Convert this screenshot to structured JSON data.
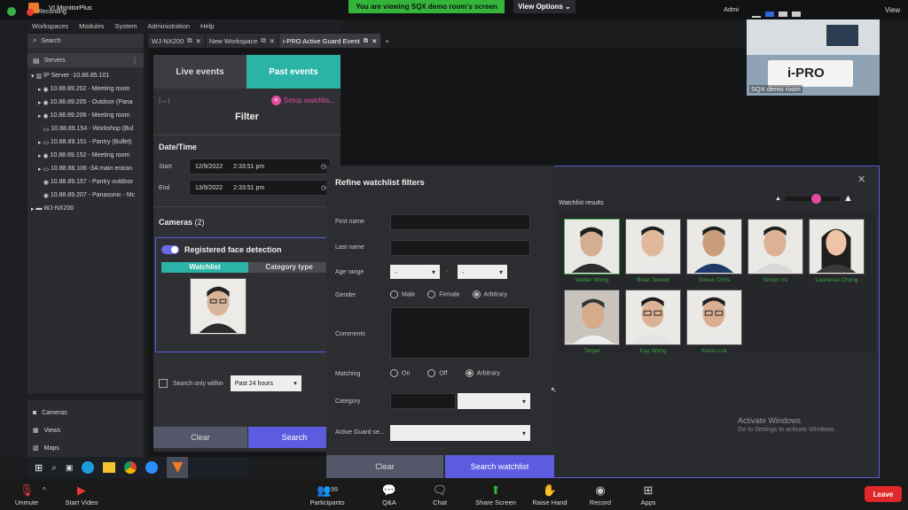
{
  "titlebar": {
    "app_title": "VI MonitorPlus",
    "recording": "Recording",
    "banner": "You are viewing SQX demo room's screen",
    "view_options": "View Options",
    "admin_label": "Admi",
    "view_label": "View"
  },
  "menu": [
    "Workspaces",
    "Modules",
    "System",
    "Administration",
    "Help"
  ],
  "sidebar": {
    "search": "Search",
    "servers": "Servers",
    "tree": [
      {
        "label": "IP Server -10.88.85.101",
        "level": 0
      },
      {
        "label": "10.88.89.202 - Meeting room",
        "level": 1
      },
      {
        "label": "10.88.89.205 - Outdoor (Pana",
        "level": 1
      },
      {
        "label": "10.88.89.206 - Meeting room",
        "level": 1
      },
      {
        "label": "10.88.89.154 - Workshop (Bul",
        "level": 1
      },
      {
        "label": "10.88.89.151 - Pantry (Bullet)",
        "level": 1
      },
      {
        "label": "10.88.89.152 - Meeting room",
        "level": 1
      },
      {
        "label": "10.88.88.106 -3A main entran",
        "level": 1
      },
      {
        "label": "10.88.89.157 - Pantry outdoor",
        "level": 1
      },
      {
        "label": "10.88.89.207 - Panasonic - Mc",
        "level": 1
      },
      {
        "label": "WJ-NX200",
        "level": 0
      }
    ],
    "bottom": [
      "Cameras",
      "Views",
      "Maps"
    ]
  },
  "tabs": [
    "WJ-NX200",
    "New Workspace",
    "i-PRO Active Guard Event"
  ],
  "panel": {
    "live_events": "Live events",
    "past_events": "Past events",
    "setup_watchlist": "Setup watchlis...",
    "filter": "Filter",
    "date_time": "Date/Time",
    "start_label": "Start",
    "start_date": "12/9/2022",
    "start_time": "2:33:51 pm",
    "end_label": "End",
    "end_date": "13/9/2022",
    "end_time": "2:33:51 pm",
    "cameras": "Cameras",
    "cameras_count": "(2)",
    "registered_face": "Registered face detection",
    "watchlist_tab": "Watchlist",
    "category_tab": "Category type",
    "search_only": "Search only within",
    "past_24": "Past 24 hours",
    "clear": "Clear",
    "search": "Search"
  },
  "modal": {
    "title": "Refine watchlist filters",
    "first_name": "First name",
    "last_name": "Last name",
    "age_range": "Age range",
    "age_from": "-",
    "age_to": "-",
    "gender": "Gender",
    "male": "Male",
    "female": "Female",
    "arbitrary": "Arbitrary",
    "comments": "Comments",
    "matching": "Matching",
    "on": "On",
    "off": "Off",
    "category": "Category",
    "active_guard": "Active Guard se...",
    "clear": "Clear",
    "search_watchlist": "Search watchlist",
    "results_title": "Watchlist results",
    "results": [
      "Walter Wong",
      "Brian Teonet",
      "Simon Chris",
      "Simon Yu",
      "Laurence Chong",
      "Target",
      "Kay Wong",
      "Kevin Lok"
    ],
    "activate_title": "Activate Windows",
    "activate_sub": "Go to Settings to activate Windows."
  },
  "video": {
    "room_label": "SQX demo room",
    "brand": "i-PRO"
  },
  "zoom": {
    "unmute": "Unmute",
    "start_video": "Start Video",
    "participants": "Participants",
    "participants_count": "99",
    "qa": "Q&A",
    "chat": "Chat",
    "share_screen": "Share Screen",
    "raise_hand": "Raise Hand",
    "record": "Record",
    "apps": "Apps",
    "leave": "Leave"
  },
  "colors": {
    "accent_teal": "#2ab3a6",
    "accent_purple": "#5c5ce0",
    "zoom_green": "#34b53a",
    "leave_red": "#e02828",
    "name_green": "#38a843"
  }
}
